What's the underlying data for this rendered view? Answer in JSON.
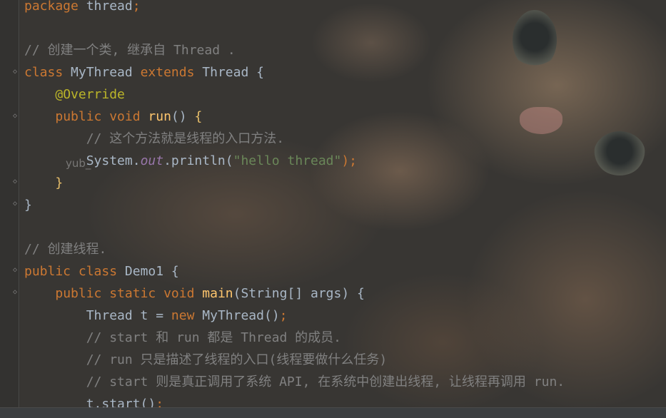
{
  "editor": {
    "lines": [
      {
        "parts": [
          {
            "t": "package ",
            "c": "kw"
          },
          {
            "t": "thread",
            "c": "cls"
          },
          {
            "t": ";",
            "c": "kw"
          }
        ]
      },
      {
        "parts": []
      },
      {
        "parts": [
          {
            "t": "// 创建一个类, 继承自 Thread .",
            "c": "cm"
          }
        ]
      },
      {
        "parts": [
          {
            "t": "class ",
            "c": "kw"
          },
          {
            "t": "MyThread ",
            "c": "cls"
          },
          {
            "t": "extends ",
            "c": "kw"
          },
          {
            "t": "Thread ",
            "c": "cls"
          },
          {
            "t": "{",
            "c": "cls"
          }
        ]
      },
      {
        "parts": [
          {
            "t": "    ",
            "c": "cls"
          },
          {
            "t": "@Override",
            "c": "ann"
          }
        ]
      },
      {
        "parts": [
          {
            "t": "    ",
            "c": "cls"
          },
          {
            "t": "public ",
            "c": "kw"
          },
          {
            "t": "void ",
            "c": "kw"
          },
          {
            "t": "run",
            "c": "fn"
          },
          {
            "t": "() ",
            "c": "cls"
          },
          {
            "t": "{",
            "c": "br"
          }
        ]
      },
      {
        "parts": [
          {
            "t": "        ",
            "c": "cls"
          },
          {
            "t": "// 这个方法就是线程的入口方法.",
            "c": "cm"
          }
        ]
      },
      {
        "parts": [
          {
            "t": "        ",
            "c": "cls"
          },
          {
            "t": "System.",
            "c": "cls"
          },
          {
            "t": "out",
            "c": "it"
          },
          {
            "t": ".println(",
            "c": "cls"
          },
          {
            "t": "\"hello thread\"",
            "c": "str"
          },
          {
            "t": ");",
            "c": "kw"
          }
        ]
      },
      {
        "parts": [
          {
            "t": "    ",
            "c": "cls"
          },
          {
            "t": "}",
            "c": "br"
          }
        ]
      },
      {
        "parts": [
          {
            "t": "}",
            "c": "cls"
          }
        ]
      },
      {
        "parts": []
      },
      {
        "parts": [
          {
            "t": "// 创建线程.",
            "c": "cm"
          }
        ]
      },
      {
        "parts": [
          {
            "t": "public ",
            "c": "kw"
          },
          {
            "t": "class ",
            "c": "kw"
          },
          {
            "t": "Demo1 ",
            "c": "cls"
          },
          {
            "t": "{",
            "c": "cls"
          }
        ]
      },
      {
        "parts": [
          {
            "t": "    ",
            "c": "cls"
          },
          {
            "t": "public ",
            "c": "kw"
          },
          {
            "t": "static ",
            "c": "kw"
          },
          {
            "t": "void ",
            "c": "kw"
          },
          {
            "t": "main",
            "c": "fn"
          },
          {
            "t": "(String[] args) {",
            "c": "cls"
          }
        ]
      },
      {
        "parts": [
          {
            "t": "        ",
            "c": "cls"
          },
          {
            "t": "Thread t = ",
            "c": "cls"
          },
          {
            "t": "new ",
            "c": "kw"
          },
          {
            "t": "MyThread()",
            "c": "cls"
          },
          {
            "t": ";",
            "c": "kw"
          }
        ]
      },
      {
        "parts": [
          {
            "t": "        ",
            "c": "cls"
          },
          {
            "t": "// start 和 run 都是 Thread 的成员.",
            "c": "cm"
          }
        ]
      },
      {
        "parts": [
          {
            "t": "        ",
            "c": "cls"
          },
          {
            "t": "// run 只是描述了线程的入口(线程要做什么任务)",
            "c": "cm"
          }
        ]
      },
      {
        "parts": [
          {
            "t": "        ",
            "c": "cls"
          },
          {
            "t": "// start 则是真正调用了系统 API, 在系统中创建出线程, 让线程再调用 run.",
            "c": "cm"
          }
        ]
      },
      {
        "parts": [
          {
            "t": "        ",
            "c": "cls"
          },
          {
            "t": "t.start()",
            "c": "cls"
          },
          {
            "t": ";",
            "c": "kw"
          }
        ]
      }
    ]
  },
  "watermark": "yub_"
}
